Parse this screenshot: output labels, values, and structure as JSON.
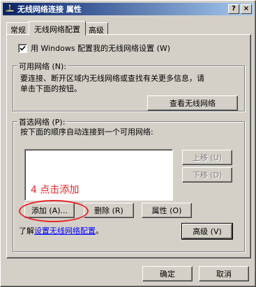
{
  "window": {
    "title": "无线网络连接 属性",
    "help_label": "?",
    "close_label": "×",
    "icon": "network-icon"
  },
  "tabs": [
    {
      "label": "常规"
    },
    {
      "label": "无线网络配置"
    },
    {
      "label": "高级"
    }
  ],
  "use_windows": {
    "checked": true,
    "label": "用 Windows 配置我的无线网络设置 (W)"
  },
  "available": {
    "title": "可用网络 (N):",
    "line1": "要连接、断开区域内无线网络或查找有关更多信息，请",
    "line2": "单击下面的按钮。",
    "view_button": "查看无线网络"
  },
  "preferred": {
    "title": "首选网络 (P):",
    "desc": "按下面的顺序自动连接到一个可用网络:",
    "items": [],
    "move_up": "上移 (U)",
    "move_down": "下移 (D)",
    "add": "添加 (A)...",
    "remove": "删除 (R)",
    "properties": "属性 (O)"
  },
  "annotation": {
    "text": "4 点击添加",
    "color": "#e8262a"
  },
  "learn": {
    "prefix": "了解",
    "link": "设置无线网络配置",
    "suffix": "。"
  },
  "advanced_button": "高级 (V)",
  "footer": {
    "ok": "确定",
    "cancel": "取消"
  }
}
